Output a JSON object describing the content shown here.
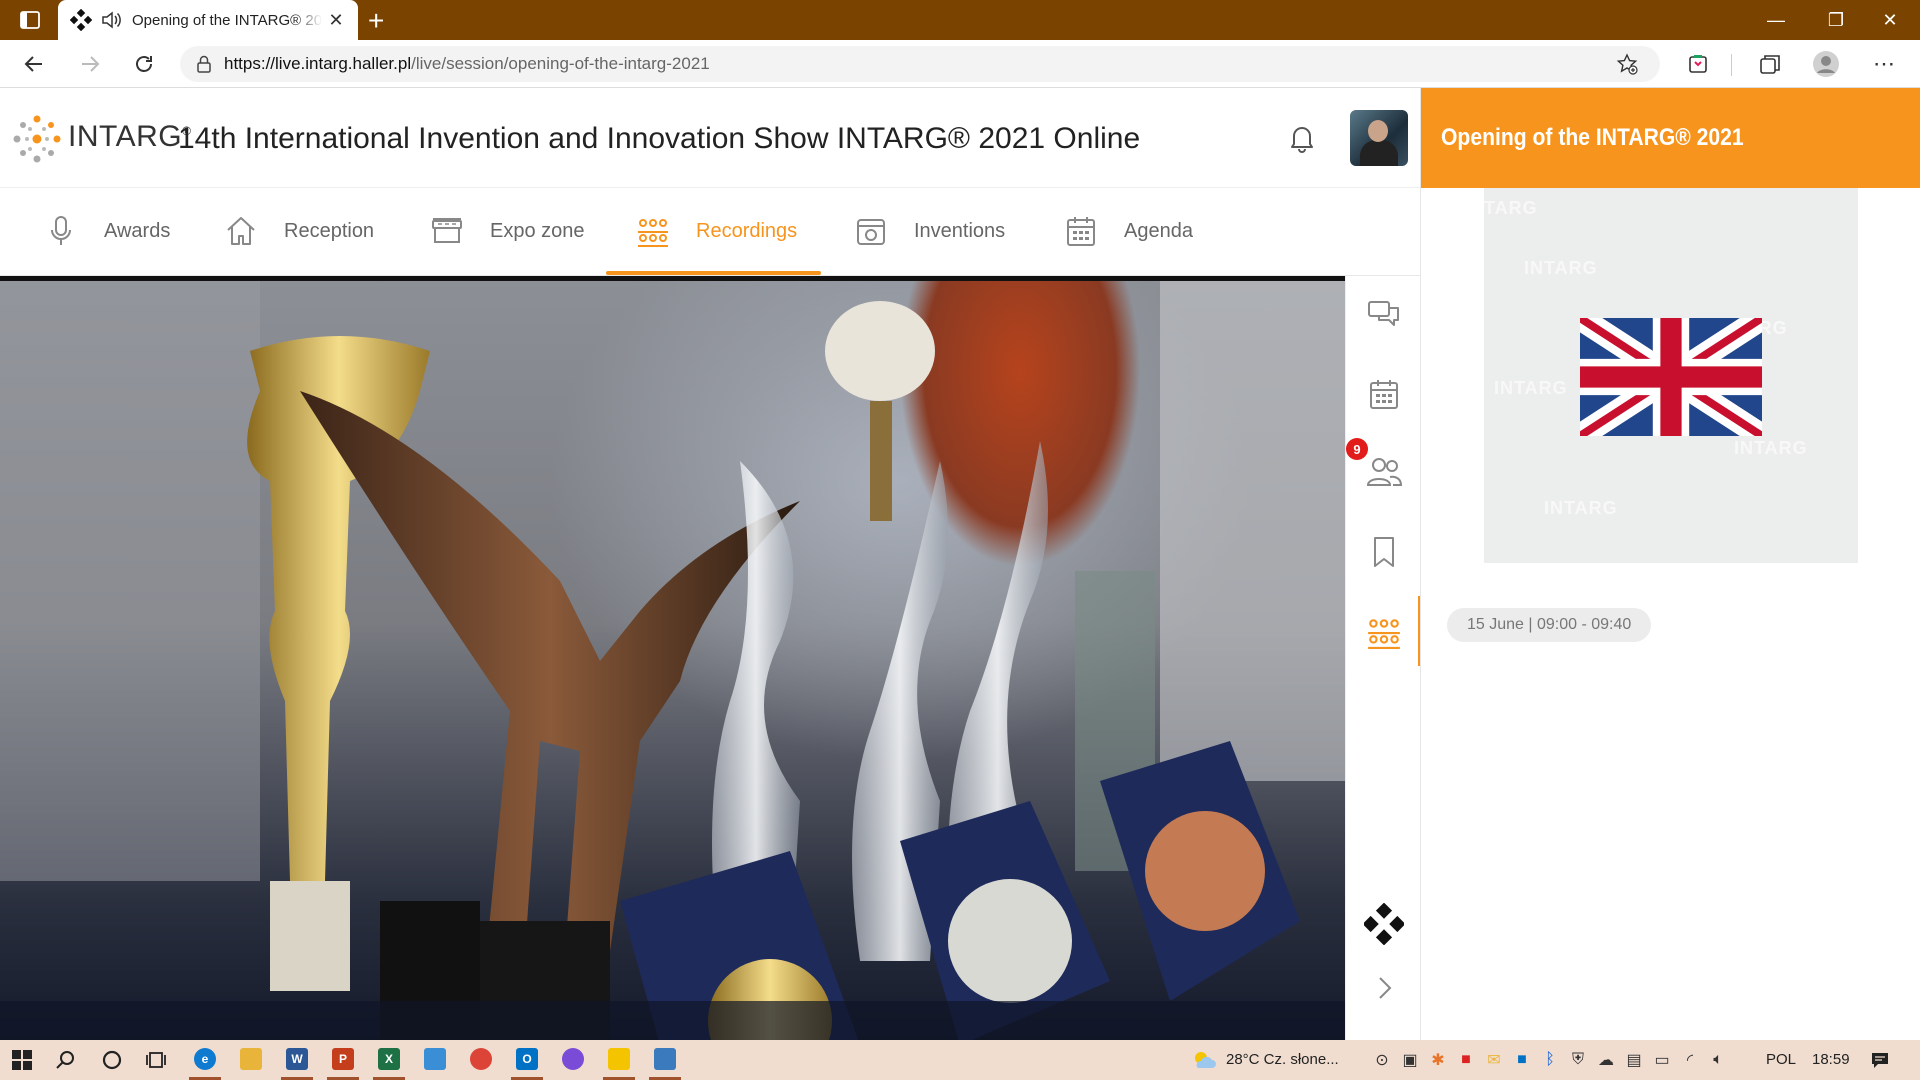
{
  "browser": {
    "tab_title": "Opening of the INTARG® 2021",
    "tab_close": "✕",
    "new_tab": "+",
    "url_domain": "https://live.intarg.haller.pl",
    "url_path": "/live/session/opening-of-the-intarg-2021",
    "window_controls": {
      "minimize": "—",
      "restore": "❐",
      "close": "✕"
    }
  },
  "header": {
    "logo_text": "INTARG",
    "logo_reg": "®",
    "event_title": "14th International Invention and Innovation Show INTARG® 2021 Online"
  },
  "nav": {
    "items": [
      {
        "label": "Awards",
        "icon": "microphone-icon"
      },
      {
        "label": "Reception",
        "icon": "home-icon"
      },
      {
        "label": "Expo zone",
        "icon": "booth-icon"
      },
      {
        "label": "Recordings",
        "icon": "audience-icon",
        "active": true
      },
      {
        "label": "Inventions",
        "icon": "box-icon"
      },
      {
        "label": "Agenda",
        "icon": "calendar-icon"
      }
    ],
    "accent_color": "#f7941d"
  },
  "sidebar": {
    "participants_badge": "9",
    "icons": [
      "chat-icon",
      "calendar-icon",
      "participants-icon",
      "bookmark-icon",
      "recordings-icon",
      "app-logo-icon",
      "chevron-right-icon"
    ]
  },
  "session": {
    "title": "Opening of the INTARG® 2021",
    "watermark": "INTARG",
    "date": "15 June | 09:00 - 09:40"
  },
  "taskbar": {
    "weather": "28°C  Cz. słone...",
    "language": "POL",
    "time": "18:59",
    "bg_color": "#f1ddd0"
  }
}
